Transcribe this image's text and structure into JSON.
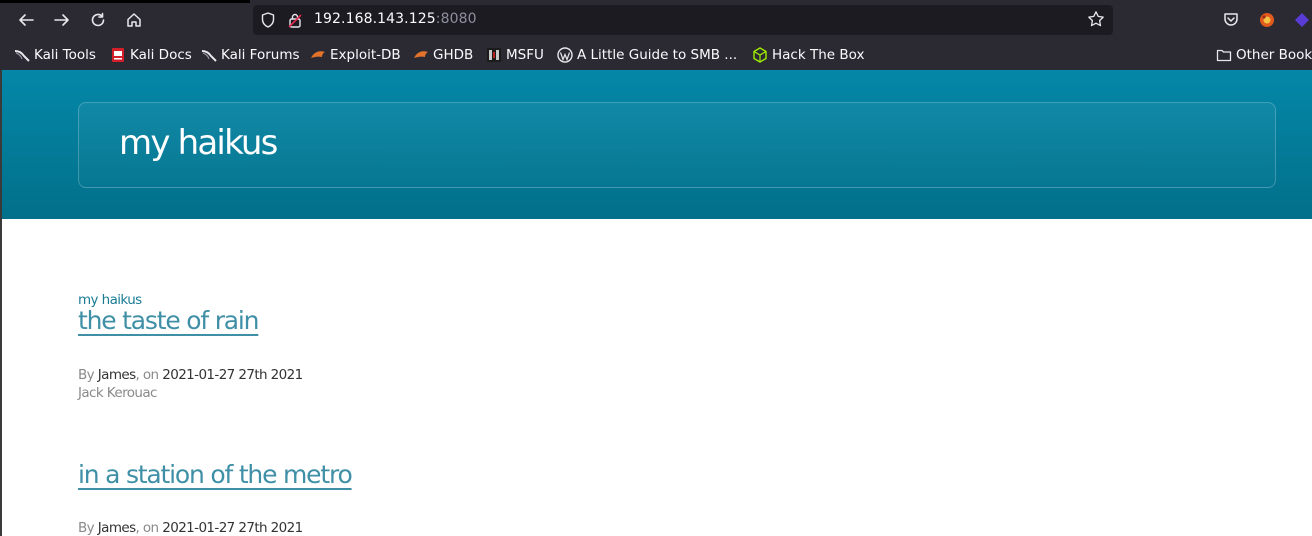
{
  "browser": {
    "url_host": "192.168.143.125",
    "url_port": ":8080"
  },
  "bookmarks": [
    {
      "label": "Kali Tools",
      "icon": "kali-dragon-icon"
    },
    {
      "label": "Kali Docs",
      "icon": "kali-docs-icon"
    },
    {
      "label": "Kali Forums",
      "icon": "kali-dragon-icon"
    },
    {
      "label": "Exploit-DB",
      "icon": "exploit-db-icon"
    },
    {
      "label": "GHDB",
      "icon": "ghdb-icon"
    },
    {
      "label": "MSFU",
      "icon": "msfu-icon"
    },
    {
      "label": "A Little Guide to SMB ...",
      "icon": "wordpress-icon"
    },
    {
      "label": "Hack The Box",
      "icon": "hackthebox-icon"
    }
  ],
  "other_bookmarks": "Other Book",
  "site": {
    "title": "my haikus"
  },
  "posts": [
    {
      "category": "my haikus",
      "title": "the taste of rain",
      "by_label": "By",
      "author": "James",
      "on_label": ", on",
      "date": "2021-01-27 27th 2021",
      "excerpt": "Jack Kerouac"
    },
    {
      "title": "in a station of the metro",
      "by_label": "By",
      "author": "James",
      "on_label": ", on",
      "date": "2021-01-27 27th 2021"
    }
  ],
  "colors": {
    "header_top": "#0487a8",
    "header_bottom": "#02708a",
    "link": "#3f8fa6",
    "chrome_bg": "#2b2a33"
  }
}
